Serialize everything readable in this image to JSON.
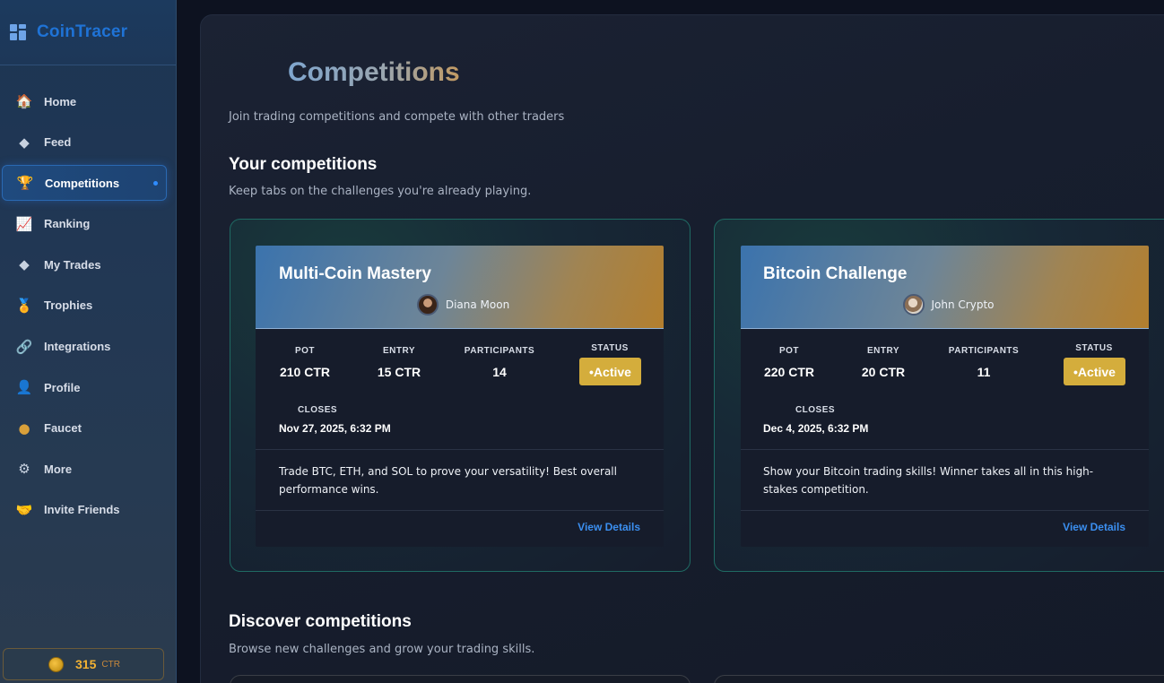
{
  "app": {
    "name": "CoinTracer"
  },
  "sidebar": {
    "items": [
      {
        "label": "Home",
        "icon": "🏠",
        "icon_name": "home-icon"
      },
      {
        "label": "Feed",
        "icon": "◆",
        "icon_name": "feed-icon"
      },
      {
        "label": "Competitions",
        "icon": "🏆",
        "icon_name": "trophy-icon",
        "active": true
      },
      {
        "label": "Ranking",
        "icon": "📈",
        "icon_name": "chart-icon"
      },
      {
        "label": "My Trades",
        "icon": "◆",
        "icon_name": "trades-icon"
      },
      {
        "label": "Trophies",
        "icon": "🏅",
        "icon_name": "medal-icon"
      },
      {
        "label": "Integrations",
        "icon": "🔗",
        "icon_name": "link-icon"
      },
      {
        "label": "Profile",
        "icon": "👤",
        "icon_name": "user-icon"
      },
      {
        "label": "Faucet",
        "icon": "●",
        "icon_name": "coin-icon"
      },
      {
        "label": "More",
        "icon": "⚙",
        "icon_name": "gear-icon"
      },
      {
        "label": "Invite Friends",
        "icon": "🤝",
        "icon_name": "handshake-icon"
      }
    ],
    "balance": {
      "amount": "315",
      "unit": "CTR"
    }
  },
  "page": {
    "title": "Competitions",
    "subtitle": "Join trading competitions and compete with other traders"
  },
  "your_competitions": {
    "title": "Your competitions",
    "subtitle": "Keep tabs on the challenges you're already playing.",
    "labels": {
      "pot": "POT",
      "entry": "ENTRY",
      "participants": "PARTICIPANTS",
      "status": "STATUS",
      "closes": "CLOSES",
      "view_details": "View Details"
    },
    "cards": [
      {
        "title": "Multi-Coin Mastery",
        "creator": "Diana Moon",
        "pot": "210 CTR",
        "entry": "15 CTR",
        "participants": "14",
        "status": "•Active",
        "closes": "Nov 27, 2025, 6:32 PM",
        "description": "Trade BTC, ETH, and SOL to prove your versatility! Best overall performance wins."
      },
      {
        "title": "Bitcoin Challenge",
        "creator": "John Crypto",
        "pot": "220 CTR",
        "entry": "20 CTR",
        "participants": "11",
        "status": "•Active",
        "closes": "Dec 4, 2025, 6:32 PM",
        "description": "Show your Bitcoin trading skills! Winner takes all in this high-stakes competition."
      }
    ]
  },
  "discover": {
    "title": "Discover competitions",
    "subtitle": "Browse new challenges and grow your trading skills."
  },
  "colors": {
    "accent": "#1f73d6",
    "status_active": "#d4ad3c",
    "link": "#3b8ff0"
  }
}
